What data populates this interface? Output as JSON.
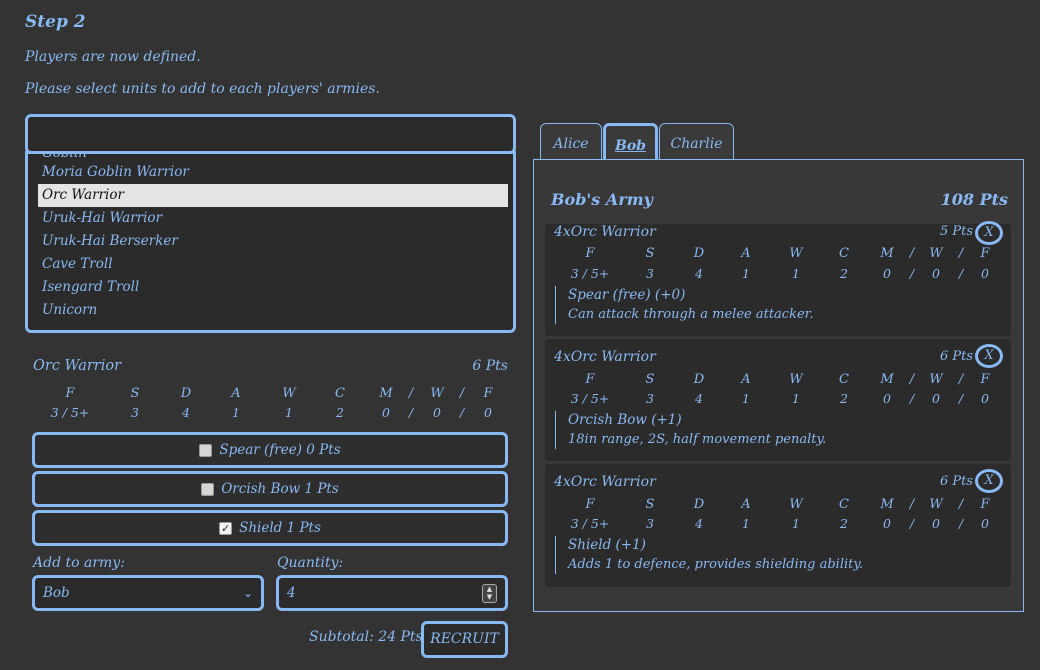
{
  "heading": {
    "step": "Step 2",
    "line1": "Players are now defined.",
    "line2": "Please select units to add to each players' armies."
  },
  "unit_search": {
    "value": ""
  },
  "unit_list": {
    "partial_item": "Goblin",
    "items": [
      "Moria Goblin Warrior",
      "Orc Warrior",
      "Uruk-Hai Warrior",
      "Uruk-Hai Berserker",
      "Cave Troll",
      "Isengard Troll",
      "Unicorn"
    ],
    "selected": "Orc Warrior"
  },
  "selected_unit": {
    "name": "Orc Warrior",
    "pts": "6 Pts",
    "stat_headers": [
      "F",
      "S",
      "D",
      "A",
      "W",
      "C",
      "M",
      "/",
      "W",
      "/",
      "F"
    ],
    "stat_values": [
      "3 / 5+",
      "3",
      "4",
      "1",
      "1",
      "2",
      "0",
      "/",
      "0",
      "/",
      "0"
    ],
    "options": [
      {
        "label": "Spear (free) 0 Pts",
        "checked": false
      },
      {
        "label": "Orcish Bow 1 Pts",
        "checked": false
      },
      {
        "label": "Shield 1 Pts",
        "checked": true
      }
    ]
  },
  "form": {
    "add_label": "Add to army:",
    "army_value": "Bob",
    "qty_label": "Quantity:",
    "qty_value": "4",
    "subtotal": "Subtotal: 24 Pts",
    "recruit": "RECRUIT"
  },
  "tabs": [
    {
      "label": "Alice",
      "active": false
    },
    {
      "label": "Bob",
      "active": true
    },
    {
      "label": "Charlie",
      "active": false
    }
  ],
  "army": {
    "title": "Bob's Army",
    "pts": "108 Pts",
    "close_label": "X",
    "entries": [
      {
        "name": "4xOrc Warrior",
        "pts": "5 Pts",
        "option": "Spear (free) (+0)",
        "desc": "Can attack through a melee attacker."
      },
      {
        "name": "4xOrc Warrior",
        "pts": "6 Pts",
        "option": "Orcish Bow (+1)",
        "desc": "18in range, 2S, half movement penalty."
      },
      {
        "name": "4xOrc Warrior",
        "pts": "6 Pts",
        "option": "Shield (+1)",
        "desc": "Adds 1 to defence, provides shielding ability."
      }
    ]
  },
  "colors": {
    "accent": "#88b9f3",
    "background": "#333333",
    "card": "#2b2b2b"
  }
}
